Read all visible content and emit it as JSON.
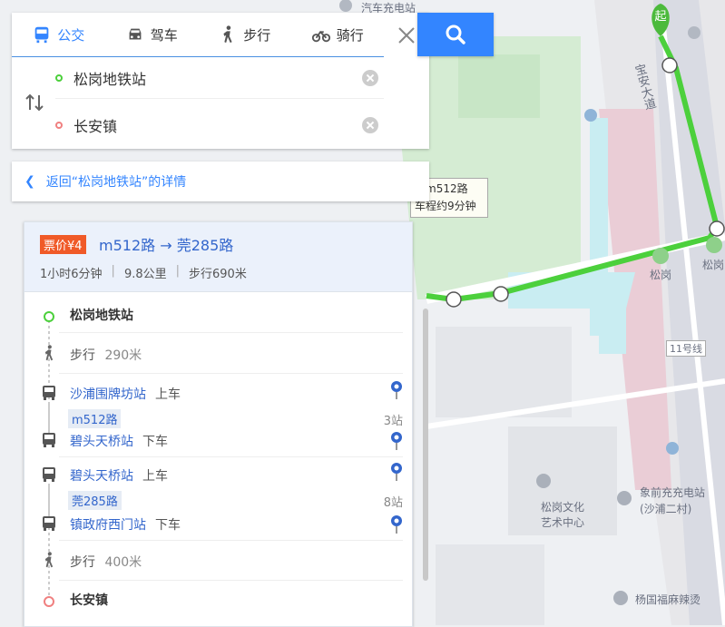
{
  "tabs": [
    {
      "label": "公交",
      "icon": "bus-icon",
      "active": true
    },
    {
      "label": "驾车",
      "icon": "car-icon",
      "active": false
    },
    {
      "label": "步行",
      "icon": "walk-icon",
      "active": false
    },
    {
      "label": "骑行",
      "icon": "bike-icon",
      "active": false
    }
  ],
  "origin": {
    "value": "松岗地铁站"
  },
  "destination": {
    "value": "长安镇"
  },
  "back_link": {
    "text": "返回“松岗地铁站”的详情"
  },
  "route": {
    "fare": "票价¥4",
    "title": "m512路 → 莞285路",
    "duration": "1小时6分钟",
    "distance": "9.8公里",
    "walk": "步行690米"
  },
  "steps": {
    "start": "松岗地铁站",
    "walk1_label": "步行",
    "walk1_dist": "290米",
    "board1_station": "沙浦围牌坊站",
    "board1_action": "上车",
    "line1": "m512路",
    "line1_stops": "3站",
    "alight1_station": "碧头天桥站",
    "alight1_action": "下车",
    "board2_station": "碧头天桥站",
    "board2_action": "上车",
    "line2": "莞285路",
    "line2_stops": "8站",
    "alight2_station": "镇政府西门站",
    "alight2_action": "下车",
    "walk2_label": "步行",
    "walk2_dist": "400米",
    "end": "长安镇"
  },
  "map": {
    "tooltip_line1": "坐m512路",
    "tooltip_line2": "车程约9分钟",
    "label_top": "汽车充电站",
    "label_road": "宝安大道",
    "label_songgang": "松岗",
    "label_songgang2": "松岗",
    "label_line11": "11号线",
    "label_arts1": "松岗文化",
    "label_arts2": "艺术中心",
    "label_charge1": "象前充充电站",
    "label_charge2": "(沙浦二村)",
    "label_restaurant": "杨国福麻辣烫",
    "start_marker": "起"
  },
  "colors": {
    "accent": "#3385ff",
    "route": "#4cd03c",
    "fare": "#f05a28"
  }
}
